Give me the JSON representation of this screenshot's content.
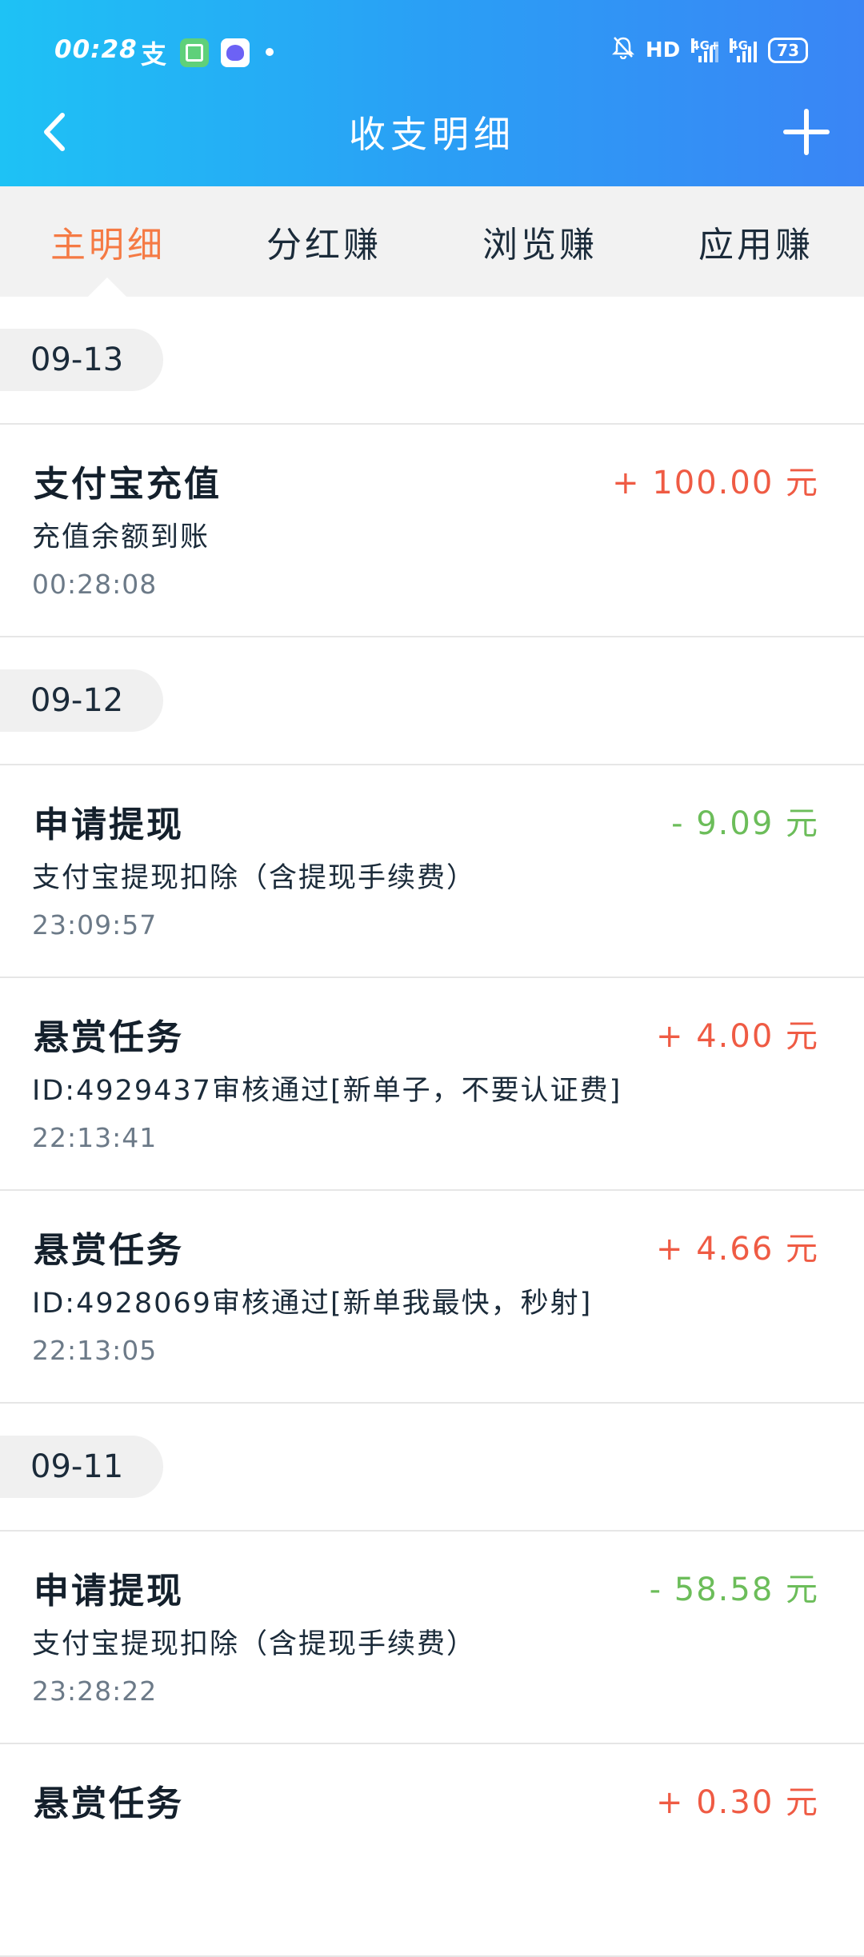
{
  "status_bar": {
    "time": "00:28",
    "hd_label": "HD",
    "net_label_1": "4G+",
    "net_label_2": "4G",
    "battery": "73"
  },
  "header": {
    "title": "收支明细"
  },
  "tabs": [
    {
      "label": "主明细",
      "active": true
    },
    {
      "label": "分红赚",
      "active": false
    },
    {
      "label": "浏览赚",
      "active": false
    },
    {
      "label": "应用赚",
      "active": false
    }
  ],
  "sections": [
    {
      "date": "09-13",
      "records": [
        {
          "title": "支付宝充值",
          "amount": "+ 100.00 元",
          "sign": "plus",
          "desc": "充值余额到账",
          "time": "00:28:08"
        }
      ]
    },
    {
      "date": "09-12",
      "records": [
        {
          "title": "申请提现",
          "amount": "- 9.09 元",
          "sign": "minus",
          "desc": "支付宝提现扣除（含提现手续费）",
          "time": "23:09:57"
        },
        {
          "title": "悬赏任务",
          "amount": "+ 4.00 元",
          "sign": "plus",
          "desc": "ID:4929437审核通过[新单子，不要认证费]",
          "time": "22:13:41"
        },
        {
          "title": "悬赏任务",
          "amount": "+ 4.66 元",
          "sign": "plus",
          "desc": "ID:4928069审核通过[新单我最快，秒射]",
          "time": "22:13:05"
        }
      ]
    },
    {
      "date": "09-11",
      "records": [
        {
          "title": "申请提现",
          "amount": "- 58.58 元",
          "sign": "minus",
          "desc": "支付宝提现扣除（含提现手续费）",
          "time": "23:28:22"
        },
        {
          "title": "悬赏任务",
          "amount": "+ 0.30 元",
          "sign": "plus",
          "desc": "",
          "time": ""
        }
      ]
    }
  ],
  "colors": {
    "header_start": "#1ec2f5",
    "header_end": "#3a85f5",
    "tab_active": "#f57a44",
    "amount_plus": "#ef5b44",
    "amount_minus": "#6cbd5a"
  }
}
